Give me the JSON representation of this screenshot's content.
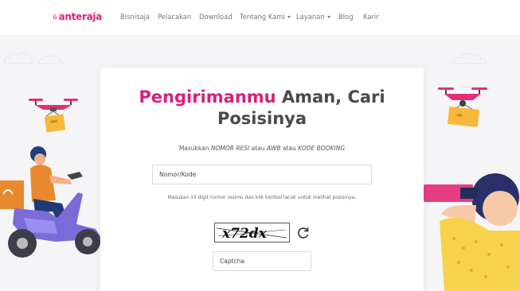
{
  "brand": {
    "name": "anteraja",
    "logo_color": "#e21f7d"
  },
  "nav": {
    "items": [
      {
        "label": "Bisnisaja",
        "dropdown": false
      },
      {
        "label": "Pelacakan",
        "dropdown": false
      },
      {
        "label": "Download",
        "dropdown": false
      },
      {
        "label": "Tentang Kami",
        "dropdown": true
      },
      {
        "label": "Layanan",
        "dropdown": true
      },
      {
        "label": "Blog",
        "dropdown": false
      },
      {
        "label": "Karir",
        "dropdown": false
      }
    ]
  },
  "tracking": {
    "headline_highlight": "Pengirimanmu",
    "headline_rest_line1": " Aman, Cari",
    "headline_line2": "Posisinya",
    "subtitle": {
      "prefix": "Masukkan ",
      "resi": "NOMOR RESI",
      "mid1": " atau ",
      "awb": "AWB",
      "mid2": " atau ",
      "booking": "KODE BOOKING"
    },
    "input_placeholder": "Nomor/Kode",
    "hint": "Masukan 13 digit nomor resimu dan klik tombol lacak untuk melihat posisinya.",
    "captcha_text": "x72dx",
    "captcha_placeholder": "Captcha"
  },
  "colors": {
    "accent": "#d81f7a",
    "drone": "#e52e7a",
    "box": "#f6b93b",
    "background": "#f5f5f7"
  }
}
